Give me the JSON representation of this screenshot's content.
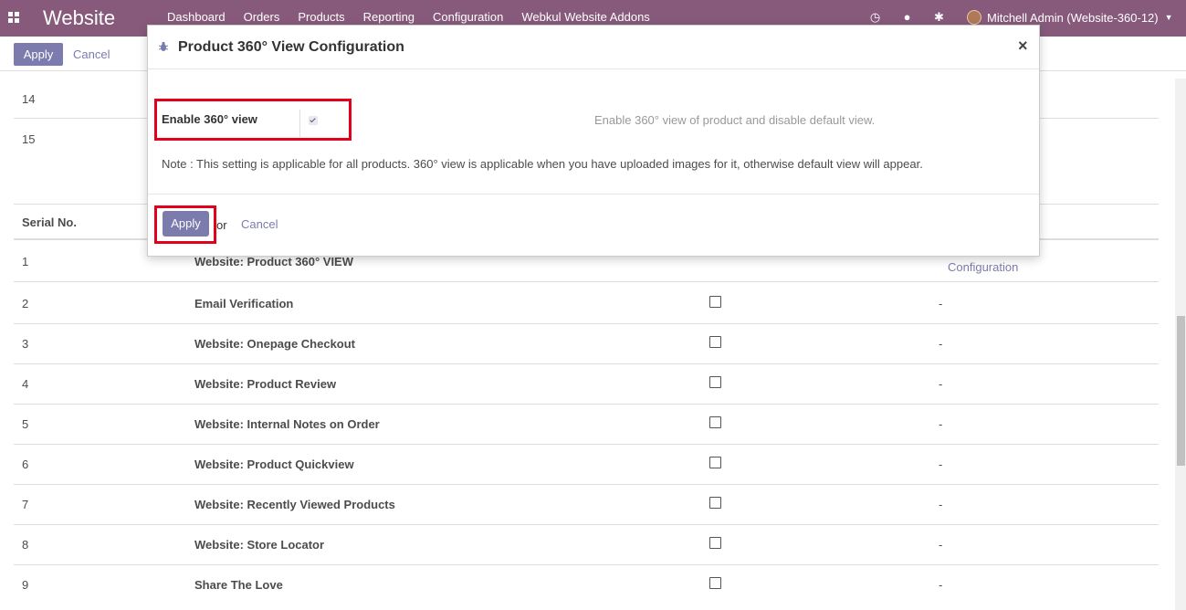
{
  "navbar": {
    "brand": "Website",
    "menu": [
      "Dashboard",
      "Orders",
      "Products",
      "Reporting",
      "Configuration",
      "Webkul Website Addons"
    ],
    "user": "Mitchell Admin (Website-360-12)"
  },
  "control_panel": {
    "apply_label": "Apply",
    "cancel_label": "Cancel"
  },
  "table": {
    "pre_rows": [
      "14",
      "15"
    ],
    "header": "Serial No.",
    "rows": [
      {
        "serial": "1",
        "name": "Website: Product 360° VIEW",
        "checked": true,
        "action": "Configuration"
      },
      {
        "serial": "2",
        "name": "Email Verification",
        "checked": false,
        "action": "-"
      },
      {
        "serial": "3",
        "name": "Website: Onepage Checkout",
        "checked": false,
        "action": "-"
      },
      {
        "serial": "4",
        "name": "Website: Product Review",
        "checked": false,
        "action": "-"
      },
      {
        "serial": "5",
        "name": "Website: Internal Notes on Order",
        "checked": false,
        "action": "-"
      },
      {
        "serial": "6",
        "name": "Website: Product Quickview",
        "checked": false,
        "action": "-"
      },
      {
        "serial": "7",
        "name": "Website: Recently Viewed Products",
        "checked": false,
        "action": "-"
      },
      {
        "serial": "8",
        "name": "Website: Store Locator",
        "checked": false,
        "action": "-"
      },
      {
        "serial": "9",
        "name": "Share The Love",
        "checked": false,
        "action": "-"
      }
    ]
  },
  "modal": {
    "title": "Product 360° View Configuration",
    "field_label": "Enable 360° view",
    "field_checked": true,
    "help_text": "Enable 360° view of product and disable default view.",
    "note": "Note : This setting is applicable for all products. 360° view is applicable when you have uploaded images for it, otherwise default view will appear.",
    "apply_label": "Apply",
    "or_text": "or",
    "cancel_label": "Cancel",
    "close_label": "×"
  },
  "colors": {
    "navbar": "#875a7b",
    "primary": "#7c7bad",
    "highlight": "#e3001b"
  }
}
